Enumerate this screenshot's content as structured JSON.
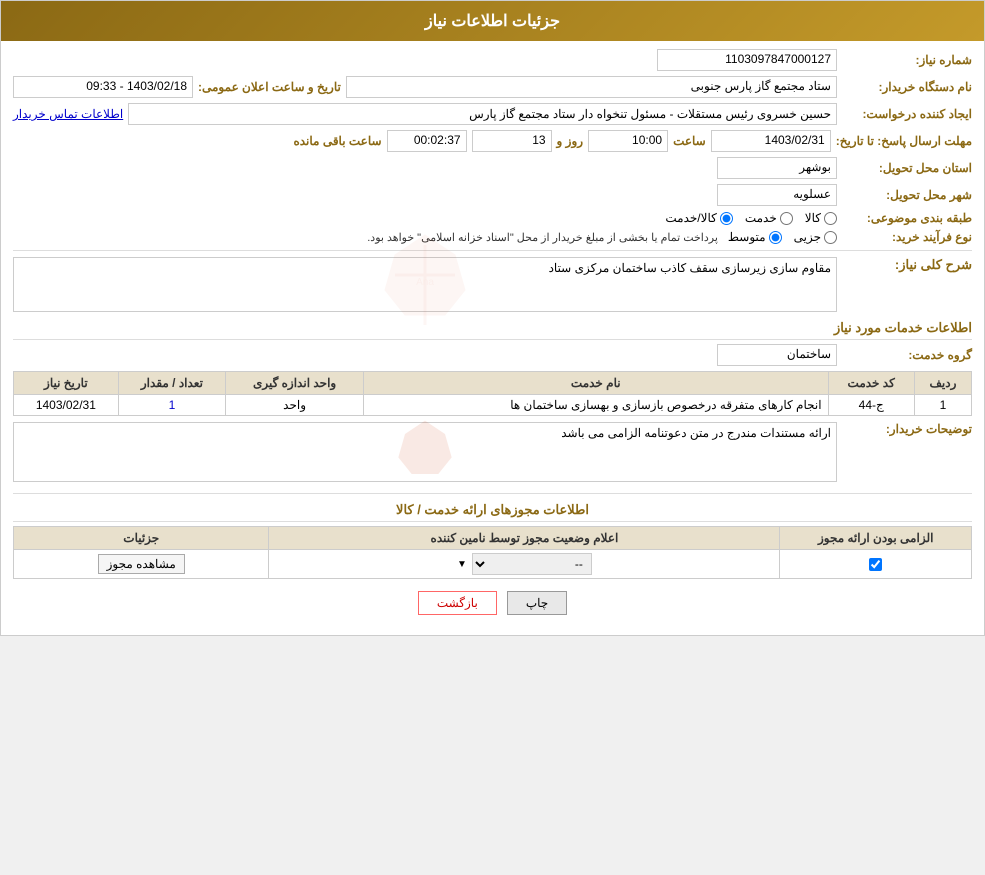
{
  "page": {
    "title": "جزئیات اطلاعات نیاز"
  },
  "fields": {
    "request_number_label": "شماره نیاز:",
    "request_number_value": "1103097847000127",
    "org_label": "نام دستگاه خریدار:",
    "org_value": "ستاد مجتمع گاز پارس جنوبی",
    "announce_date_label": "تاریخ و ساعت اعلان عمومی:",
    "announce_date_value": "1403/02/18 - 09:33",
    "creator_label": "ایجاد کننده درخواست:",
    "creator_value": "حسین خسروی رئیس مستقلات - مسئول تنخواه دار ستاد مجتمع گاز پارس",
    "contact_link": "اطلاعات تماس خریدار",
    "response_deadline_label": "مهلت ارسال پاسخ: تا تاریخ:",
    "deadline_date": "1403/02/31",
    "deadline_time_label": "ساعت",
    "deadline_time": "10:00",
    "deadline_day_label": "روز و",
    "deadline_days": "13",
    "deadline_countdown_label": "ساعت باقی مانده",
    "deadline_countdown": "00:02:37",
    "delivery_province_label": "استان محل تحویل:",
    "delivery_province": "بوشهر",
    "delivery_city_label": "شهر محل تحویل:",
    "delivery_city": "عسلویه",
    "category_label": "طبقه بندی موضوعی:",
    "category_options": [
      "کالا",
      "خدمت",
      "کالا/خدمت"
    ],
    "category_selected": "کالا/خدمت",
    "purchase_type_label": "نوع فرآیند خرید:",
    "purchase_type_options": [
      "جزیی",
      "متوسط"
    ],
    "purchase_type_note": "پرداخت تمام یا بخشی از مبلغ خریدار از محل \"اسناد خزانه اسلامی\" خواهد بود.",
    "general_desc_label": "شرح کلی نیاز:",
    "general_desc_value": "مقاوم سازی زیرسازی سقف کاذب ساختمان مرکزی ستاد",
    "services_info_label": "اطلاعات خدمات مورد نیاز",
    "service_group_label": "گروه خدمت:",
    "service_group_value": "ساختمان",
    "table": {
      "headers": [
        "ردیف",
        "کد خدمت",
        "نام خدمت",
        "واحد اندازه گیری",
        "تعداد / مقدار",
        "تاریخ نیاز"
      ],
      "rows": [
        {
          "num": "1",
          "code": "ج-44",
          "name": "انجام کارهای متفرقه درخصوص بازسازی و بهسازی ساختمان ها",
          "unit": "واحد",
          "qty": "1",
          "date": "1403/02/31"
        }
      ]
    },
    "buyer_notes_label": "توضیحات خریدار:",
    "buyer_notes_value": "ارائه مستندات مندرج در متن دعوتنامه الزامی می باشد",
    "license_section_label": "اطلاعات مجوزهای ارائه خدمت / کالا",
    "license_table": {
      "headers": [
        "الزامی بودن ارائه مجوز",
        "اعلام وضعیت مجوز توسط نامین کننده",
        "جزئیات"
      ],
      "rows": [
        {
          "required": true,
          "status": "--",
          "details_btn": "مشاهده مجوز"
        }
      ]
    },
    "buttons": {
      "print": "چاپ",
      "back": "بازگشت"
    }
  }
}
